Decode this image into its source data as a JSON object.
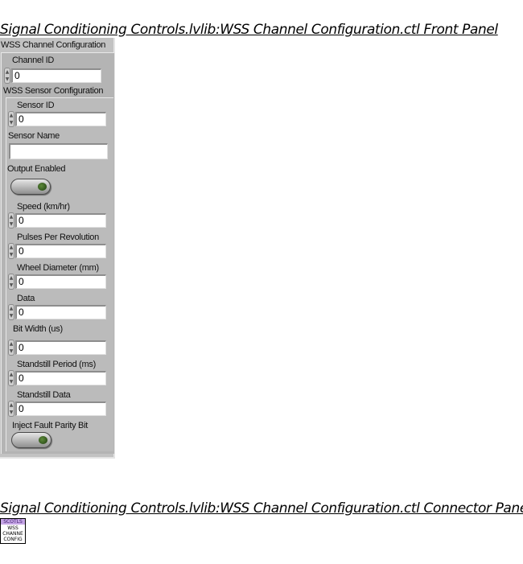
{
  "front_panel_title": "Signal Conditioning Controls.lvlib:WSS Channel Configuration.ctl Front Panel",
  "connector_pane_title": "Signal Conditioning Controls.lvlib:WSS Channel Configuration.ctl Connector Pane",
  "cluster": {
    "label": "WSS Channel Configuration",
    "channel_id": {
      "label": "Channel ID",
      "value": "0"
    },
    "sensor_cluster": {
      "label": "WSS Sensor Configuration",
      "sensor_id": {
        "label": "Sensor ID",
        "value": "0"
      },
      "sensor_name": {
        "label": "Sensor Name",
        "value": ""
      },
      "output_enabled": {
        "label": "Output Enabled",
        "state": "on"
      },
      "speed": {
        "label": "Speed (km/hr)",
        "value": "0"
      },
      "pulses_per_revolution": {
        "label": "Pulses Per Revolution",
        "value": "0"
      },
      "wheel_diameter": {
        "label": "Wheel Diameter (mm)",
        "value": "0"
      },
      "data": {
        "label": "Data",
        "value": "0"
      },
      "bit_width": {
        "label": "Bit Width (us)",
        "value": "0"
      },
      "standstill_period": {
        "label": "Standstill Period (ms)",
        "value": "0"
      },
      "standstill_data": {
        "label": "Standstill Data",
        "value": "0"
      },
      "inject_fault_parity_bit": {
        "label": "Inject Fault Parity Bit",
        "state": "on"
      }
    }
  },
  "connector_icon": {
    "band_text": "SCOTLS",
    "lines": [
      "WSS",
      "CHANNE",
      "CONFIG"
    ],
    "band_color": "#c6a6e6"
  },
  "colors": {
    "panel_bg": "#c2c2c2",
    "toggle_led": "#3f6b22"
  }
}
